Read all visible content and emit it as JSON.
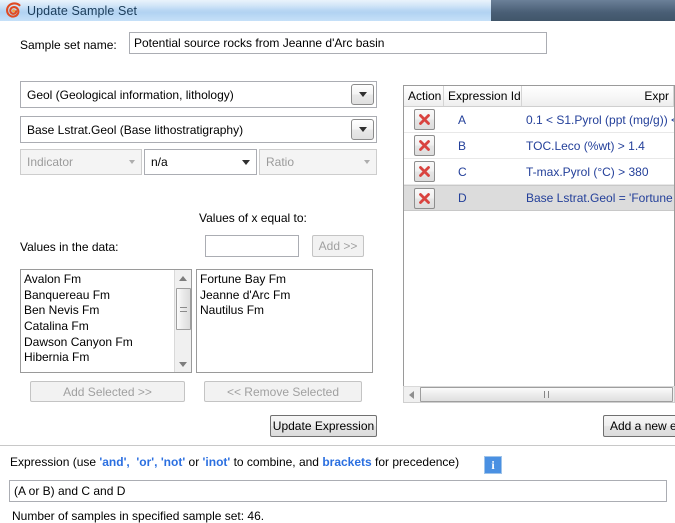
{
  "window": {
    "title": "Update Sample Set",
    "icon": "app-spiral-icon"
  },
  "form": {
    "sample_set_name_label": "Sample set name:",
    "sample_set_name_value": "Potential source rocks from Jeanne d'Arc basin",
    "category_combo_value": "Geol (Geological information, lithology)",
    "property_combo_value": "Base Lstrat.Geol (Base lithostratigraphy)",
    "indicator_combo_value": "Indicator",
    "na_combo_value": "n/a",
    "ratio_combo_value": "Ratio",
    "values_of_x_label": "Values of x equal to:",
    "values_in_data_label": "Values in the data:",
    "x_value_input": "",
    "add_button_label": "Add >>",
    "available_values": [
      "Avalon Fm",
      "Banquereau Fm",
      "Ben Nevis Fm",
      "Catalina Fm",
      "Dawson Canyon Fm",
      "Hibernia Fm"
    ],
    "selected_values": [
      "Fortune Bay Fm",
      "Jeanne d'Arc Fm",
      "Nautilus Fm"
    ],
    "add_selected_label": "Add Selected >>",
    "remove_selected_label": "<< Remove Selected",
    "update_expression_label": "Update Expression"
  },
  "grid": {
    "columns": [
      "Action",
      "Expression Id",
      "Expr"
    ],
    "rows": [
      {
        "id": "A",
        "expression": "0.1 < S1.Pyrol (ppt (mg/g)) <",
        "selected": false,
        "delete_icon": "red-x-icon"
      },
      {
        "id": "B",
        "expression": "TOC.Leco (%wt) > 1.4",
        "selected": false,
        "delete_icon": "red-x-icon"
      },
      {
        "id": "C",
        "expression": "T-max.Pyrol (°C) > 380",
        "selected": false,
        "delete_icon": "red-x-icon"
      },
      {
        "id": "D",
        "expression": "Base Lstrat.Geol = 'Fortune B",
        "selected": true,
        "delete_icon": "red-x-icon"
      }
    ],
    "add_new_button_label": "Add a new e"
  },
  "expression": {
    "legend_prefix": "Expression (use ",
    "kw_and": "'and',",
    "kw_or": "'or',",
    "kw_not": "'not'",
    "legend_or": " or ",
    "kw_inot": "'inot'",
    "legend_mid": " to combine, and ",
    "kw_brackets": "brackets",
    "legend_suffix": " for precedence)",
    "info_icon": "i",
    "value": "(A or B) and C and D",
    "sample_count_text": "Number of samples in specified sample set: 46."
  },
  "colors": {
    "title_bar": "#bcd9f4",
    "desktop": "#4a5f76",
    "link_blue": "#24409a",
    "keyword_blue": "#2b6fe0",
    "info_blue": "#4a90e2",
    "delete_red": "#d9433f",
    "selected_row": "#dcdcdc"
  }
}
